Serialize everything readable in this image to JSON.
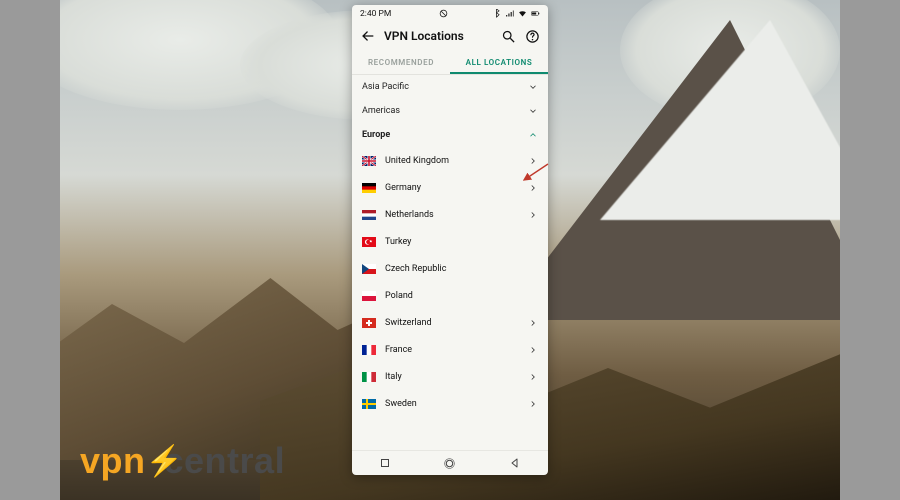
{
  "statusbar": {
    "time": "2:40 PM"
  },
  "appbar": {
    "title": "VPN Locations"
  },
  "tabs": {
    "recommended": "RECOMMENDED",
    "all": "ALL LOCATIONS"
  },
  "regions": {
    "asia_pacific": "Asia Pacific",
    "americas": "Americas",
    "europe": "Europe"
  },
  "countries": [
    {
      "name": "United Kingdom",
      "flag": "gb",
      "chev": true
    },
    {
      "name": "Germany",
      "flag": "de",
      "chev": true
    },
    {
      "name": "Netherlands",
      "flag": "nl",
      "chev": true
    },
    {
      "name": "Turkey",
      "flag": "tr",
      "chev": false
    },
    {
      "name": "Czech Republic",
      "flag": "cz",
      "chev": false
    },
    {
      "name": "Poland",
      "flag": "pl",
      "chev": false
    },
    {
      "name": "Switzerland",
      "flag": "ch",
      "chev": true
    },
    {
      "name": "France",
      "flag": "fr",
      "chev": true
    },
    {
      "name": "Italy",
      "flag": "it",
      "chev": true
    },
    {
      "name": "Sweden",
      "flag": "se",
      "chev": true
    }
  ],
  "watermark": {
    "left": "vpn",
    "right": "central"
  },
  "colors": {
    "accent": "#0f8a6f",
    "wm_orange": "#f5a623"
  }
}
